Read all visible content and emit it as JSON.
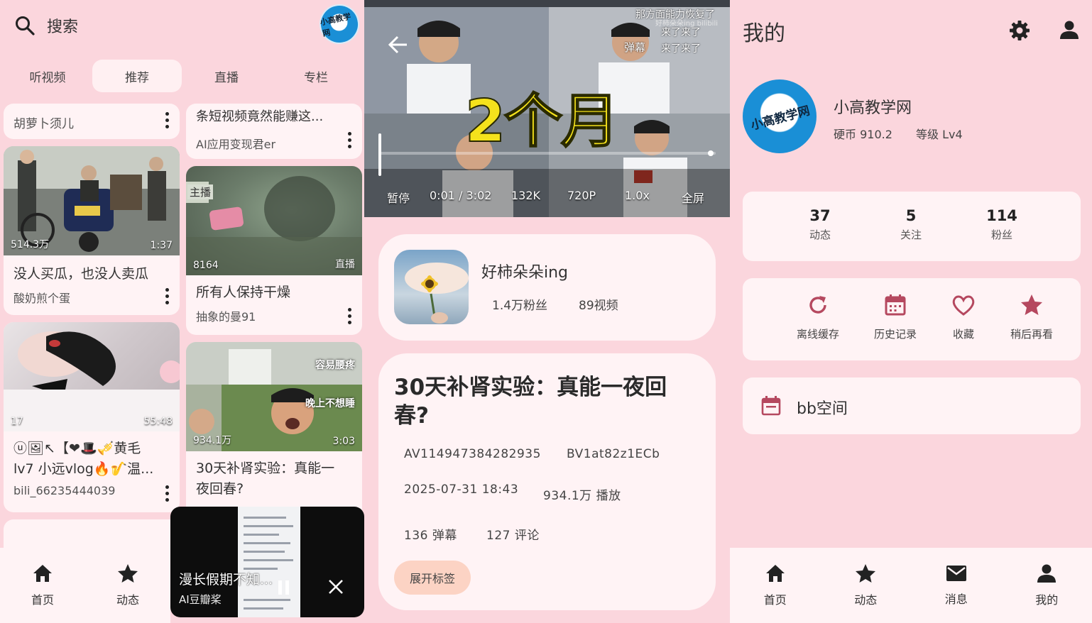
{
  "left": {
    "search": {
      "label": "搜索"
    },
    "tabs": [
      {
        "label": "听视频"
      },
      {
        "label": "推荐"
      },
      {
        "label": "直播"
      },
      {
        "label": "专栏"
      }
    ],
    "col1": [
      {
        "author": "胡萝卜须儿"
      },
      {
        "views": "514.3万",
        "duration": "1:37",
        "title": "没人买瓜，也没人卖瓜",
        "author": "酸奶煎个蛋"
      },
      {
        "views": "17",
        "duration": "55:48",
        "title": "ⓤ🖼↖【❤🎩🎺黄毛\nlv7 小远vlog🔥🎷温...",
        "author": "bili_66235444039"
      }
    ],
    "col2": [
      {
        "title": "条短视频竟然能赚这...",
        "author": "AI应用变现君er"
      },
      {
        "views": "8164",
        "duration": "直播",
        "title": "所有人保持干燥",
        "author": "抽象的曼91",
        "overlay": "主播"
      },
      {
        "views": "934.1万",
        "duration": "3:03",
        "title": "30天补肾实验：真能一\n夜回春?",
        "caption1": "容易腰疼",
        "caption2": "晚上不想睡"
      }
    ],
    "mini_player": {
      "title": "漫长假期不知...",
      "author": "AI豆瓣桨"
    },
    "nav": [
      {
        "label": "首页"
      },
      {
        "label": "动态"
      }
    ]
  },
  "middle": {
    "video": {
      "overlay_title": "2个月",
      "danmaku": [
        "那方面能力恢复了",
        "来了来了",
        "来了来了"
      ],
      "danmaku_label": "弹幕",
      "watermark": "好柿朵朵ing bilibili",
      "pause": "暂停",
      "time": "0:01 / 3:02",
      "views_short": "132K",
      "quality": "720P",
      "speed": "1.0x",
      "fullscreen": "全屏",
      "progress": 0.005
    },
    "creator": {
      "name": "好柿朵朵ing",
      "fans": "1.4万粉丝",
      "videos": "89视频"
    },
    "info": {
      "title": "30天补肾实验：真能一夜回\n春?",
      "av": "AV114947384282935",
      "bv": "BV1at82z1ECb",
      "date": "2025-07-31 18:43",
      "plays": "934.1万 播放",
      "danmaku": "136 弹幕",
      "comments": "127 评论",
      "expand": "展开标签"
    }
  },
  "right": {
    "header": {
      "title": "我的"
    },
    "profile": {
      "name": "小高教学网",
      "coins": "硬币 910.2",
      "level": "等级 Lv4",
      "logo_text": "小高教学网"
    },
    "stats": [
      {
        "n": "37",
        "l": "动态"
      },
      {
        "n": "5",
        "l": "关注"
      },
      {
        "n": "114",
        "l": "粉丝"
      }
    ],
    "actions": [
      {
        "l": "离线缓存",
        "icon": "refresh-icon"
      },
      {
        "l": "历史记录",
        "icon": "calendar-icon"
      },
      {
        "l": "收藏",
        "icon": "heart-icon"
      },
      {
        "l": "稍后再看",
        "icon": "star-icon"
      }
    ],
    "space": {
      "label": "bb空间"
    },
    "nav": [
      {
        "label": "首页"
      },
      {
        "label": "动态"
      },
      {
        "label": "消息"
      },
      {
        "label": "我的"
      }
    ]
  },
  "colors": {
    "bg": "#fbd6dd",
    "card": "#fff3f5",
    "accent": "#b5485f",
    "chip": "#fcd3c4"
  }
}
